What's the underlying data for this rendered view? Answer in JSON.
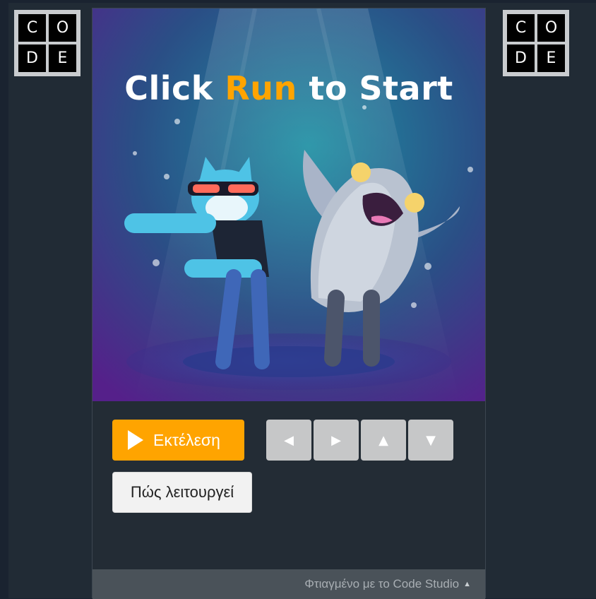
{
  "logo": {
    "letters": [
      "C",
      "O",
      "D",
      "E"
    ]
  },
  "stage": {
    "title_prefix": "Click ",
    "title_accent": "Run",
    "title_suffix": " to Start"
  },
  "controls": {
    "run_label": "Εκτέλεση",
    "how_label": "Πώς λειτουργεί",
    "arrows": [
      {
        "icon": "left-arrow-icon",
        "glyph": "◀"
      },
      {
        "icon": "right-arrow-icon",
        "glyph": "▶"
      },
      {
        "icon": "up-arrow-icon",
        "glyph": "▲"
      },
      {
        "icon": "down-arrow-icon",
        "glyph": "▼"
      }
    ]
  },
  "footer": {
    "label": "Φτιαγμένο με το Code Studio",
    "caret": "▲"
  },
  "colors": {
    "accent": "#ffa400",
    "background": "#212b35",
    "footer": "#4a5259"
  }
}
